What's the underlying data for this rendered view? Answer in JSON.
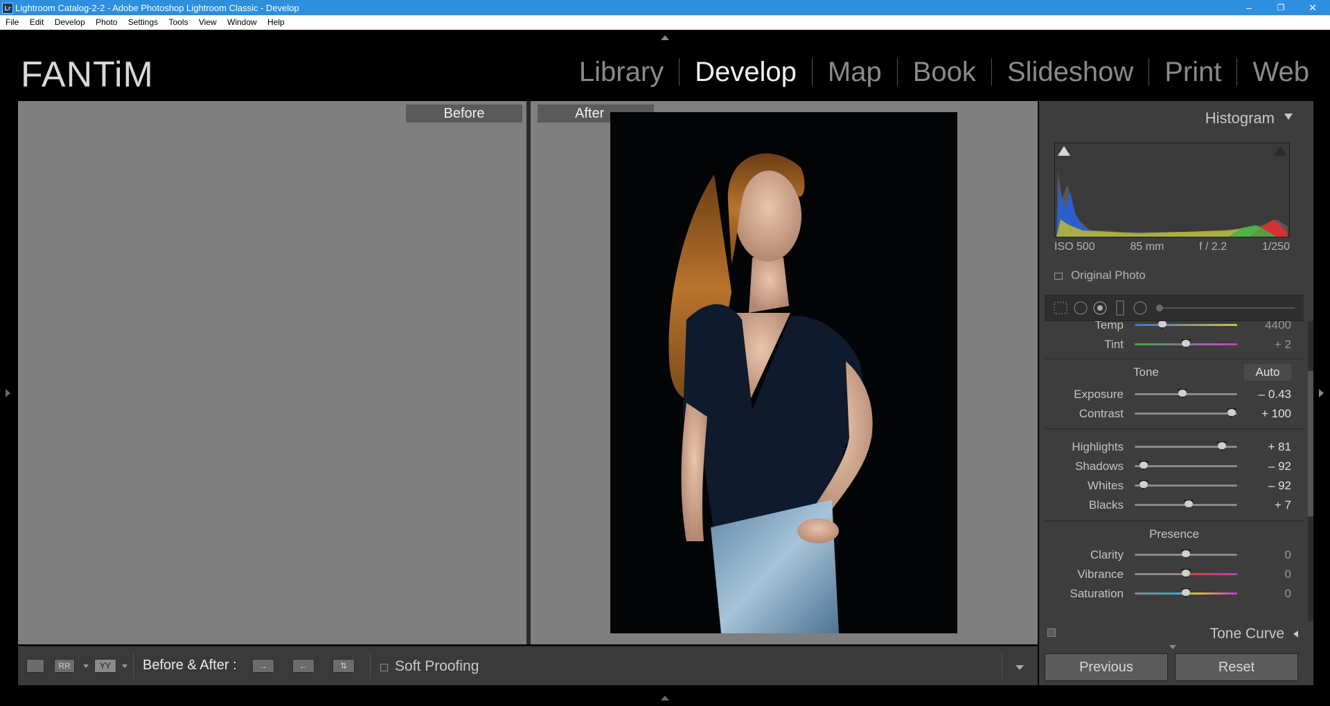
{
  "window": {
    "app_badge": "Lr",
    "title": "Lightroom Catalog-2-2 - Adobe Photoshop Lightroom Classic - Develop",
    "min": "–",
    "max": "❐",
    "close": "✕"
  },
  "menu": [
    "File",
    "Edit",
    "Develop",
    "Photo",
    "Settings",
    "Tools",
    "View",
    "Window",
    "Help"
  ],
  "identity_plate": "FANTiM",
  "modules": {
    "library": "Library",
    "develop": "Develop",
    "map": "Map",
    "book": "Book",
    "slideshow": "Slideshow",
    "print": "Print",
    "web": "Web"
  },
  "compare": {
    "before_label": "Before",
    "after_label": "After"
  },
  "toolbar": {
    "before_after_label": "Before & After :",
    "soft_proofing_label": "Soft Proofing",
    "view_icon_1": "RR",
    "view_icon_2": "YY"
  },
  "histogram": {
    "title": "Histogram",
    "iso": "ISO 500",
    "focal": "85 mm",
    "aperture": "f / 2.2",
    "shutter": "1/250",
    "original_photo": "Original Photo"
  },
  "basic": {
    "temp_label": "Temp",
    "temp_value": "4400",
    "tint_label": "Tint",
    "tint_value": "+ 2",
    "tone_header": "Tone",
    "auto_label": "Auto",
    "exposure_label": "Exposure",
    "exposure_value": "– 0.43",
    "contrast_label": "Contrast",
    "contrast_value": "+ 100",
    "highlights_label": "Highlights",
    "highlights_value": "+ 81",
    "shadows_label": "Shadows",
    "shadows_value": "– 92",
    "whites_label": "Whites",
    "whites_value": "– 92",
    "blacks_label": "Blacks",
    "blacks_value": "+ 7",
    "presence_header": "Presence",
    "clarity_label": "Clarity",
    "clarity_value": "0",
    "vibrance_label": "Vibrance",
    "vibrance_value": "0",
    "saturation_label": "Saturation",
    "saturation_value": "0"
  },
  "tone_curve_label": "Tone Curve",
  "buttons": {
    "previous": "Previous",
    "reset": "Reset"
  }
}
